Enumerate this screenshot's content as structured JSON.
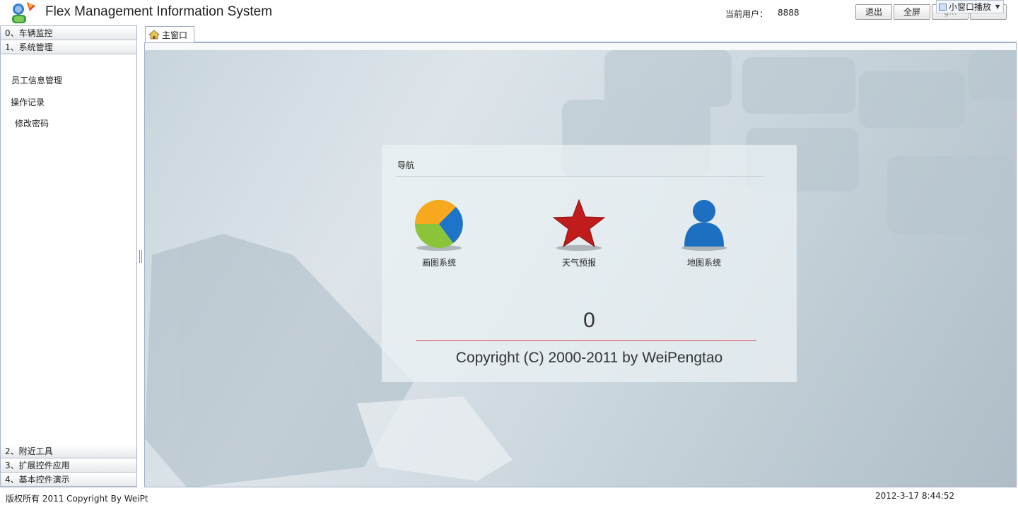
{
  "header": {
    "title": "Flex Management Information System",
    "user_label": "当前用户：",
    "user_value": "8888",
    "buttons": {
      "logout": "退出",
      "fullscreen": "全屏",
      "hidden": "g..."
    },
    "mini_window": "小窗口播放"
  },
  "sidebar": {
    "sections": [
      {
        "label": "0、车辆监控"
      },
      {
        "label": "1、系统管理"
      },
      {
        "label": "2、附近工具"
      },
      {
        "label": "3、扩展控件应用"
      },
      {
        "label": "4、基本控件演示"
      }
    ],
    "items": [
      {
        "label": "员工信息管理"
      },
      {
        "label": "操作记录"
      },
      {
        "label": "修改密码"
      }
    ]
  },
  "tab": {
    "label": "主窗口"
  },
  "nav": {
    "title": "导航",
    "items": [
      {
        "label": "画图系统",
        "icon": "pie-chart-icon"
      },
      {
        "label": "天气预报",
        "icon": "star-icon"
      },
      {
        "label": "地图系统",
        "icon": "user-icon"
      }
    ],
    "counter": "0",
    "copyright": "Copyright (C) 2000-2011 by WeiPengtao"
  },
  "footer": {
    "left": "版权所有 2011 Copyright  By WeiPt",
    "right": "2012-3-17 8:44:52"
  },
  "colors": {
    "border": "#a9b6c4",
    "divider_red": "#d44848",
    "content_bg": "#c8d4dc"
  }
}
